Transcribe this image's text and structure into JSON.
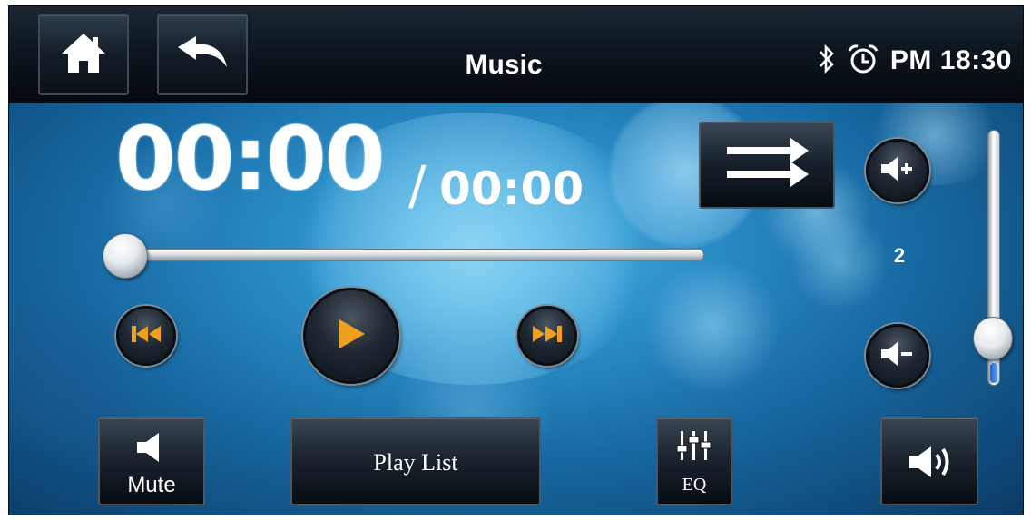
{
  "header": {
    "title": "Music",
    "clock": "PM 18:30",
    "icons": [
      "home-icon",
      "back-icon",
      "bluetooth-icon",
      "alarm-clock-icon"
    ]
  },
  "player": {
    "elapsed": "00:00",
    "separator": "/",
    "total": "00:00",
    "progress": 0,
    "icons": [
      "previous-track-icon",
      "play-icon",
      "next-track-icon",
      "repeat-icon"
    ]
  },
  "volume": {
    "value": "2",
    "level_fraction": 0.08,
    "icons": [
      "volume-up-icon",
      "volume-down-icon"
    ]
  },
  "bottom": {
    "mute_label": "Mute",
    "playlist_label": "Play List",
    "eq_label": "EQ",
    "icons": [
      "mute-icon",
      "equalizer-icon",
      "speaker-icon"
    ]
  },
  "colors": {
    "accent_orange": "#f0a020",
    "bar_dark": "#0d1620",
    "background_blue": "#2a8cc6"
  }
}
